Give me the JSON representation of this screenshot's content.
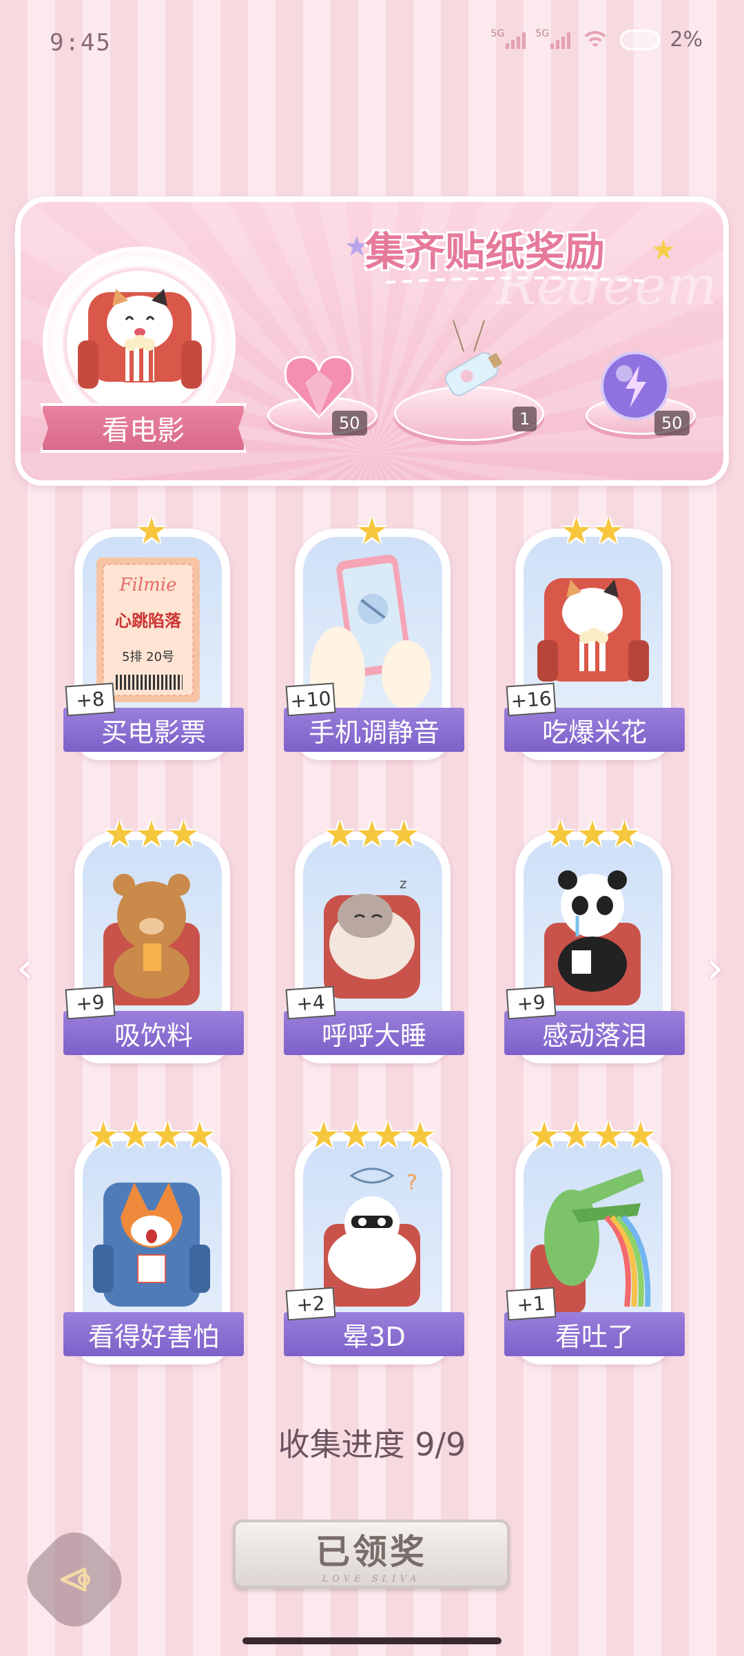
{
  "status": {
    "time": "9:45",
    "signal_1": "5G",
    "signal_2": "5G",
    "battery": "2%"
  },
  "panel": {
    "title": "集齐贴纸奖励",
    "watermark": "Redeem",
    "category": "看电影",
    "rewards": [
      {
        "name": "heart-gem",
        "count": "50"
      },
      {
        "name": "bottle",
        "count": "1"
      },
      {
        "name": "lightning-orb",
        "count": "50"
      }
    ]
  },
  "stickers": [
    {
      "label": "买电影票",
      "points": "+8",
      "stars": 1,
      "ticket": {
        "brand": "Filmie",
        "title": "心跳陷落",
        "seat": "5排 20号"
      }
    },
    {
      "label": "手机调静音",
      "points": "+10",
      "stars": 1
    },
    {
      "label": "吃爆米花",
      "points": "+16",
      "stars": 2
    },
    {
      "label": "吸饮料",
      "points": "+9",
      "stars": 3
    },
    {
      "label": "呼呼大睡",
      "points": "+4",
      "stars": 3
    },
    {
      "label": "感动落泪",
      "points": "+9",
      "stars": 3
    },
    {
      "label": "看得好害怕",
      "points": "",
      "stars": 4
    },
    {
      "label": "晕3D",
      "points": "+2",
      "stars": 4
    },
    {
      "label": "看吐了",
      "points": "+1",
      "stars": 4
    }
  ],
  "progress": "收集进度 9/9",
  "claimed_button": {
    "label": "已领奖",
    "sub": "LOVE SLIVA"
  },
  "colors": {
    "accent": "#e67a9b",
    "label_purple": "#8a6fd2",
    "star": "#f6c63d"
  }
}
